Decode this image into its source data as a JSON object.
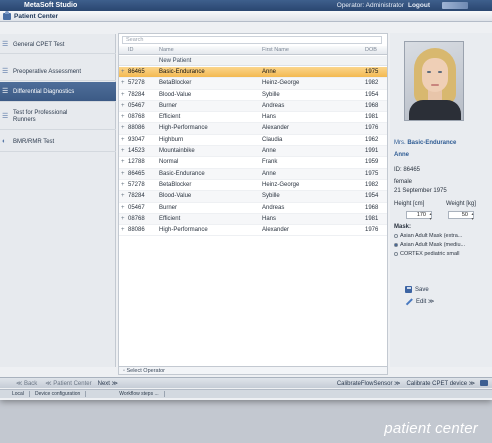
{
  "window": {
    "app_title": "MetaSoft Studio",
    "operator_label": "Operator: Administrator",
    "logout_label": "Logout",
    "section_title": "Patient Center"
  },
  "sidebar": {
    "items": [
      {
        "label": "General CPET Test",
        "icon": "run-icon",
        "active": false
      },
      {
        "label": "Preoperative Assessment",
        "icon": "run-icon",
        "active": false
      },
      {
        "label": "Differential Diagnostics",
        "icon": "stethoscope-icon",
        "active": true
      },
      {
        "label": "Test for Professional Runners",
        "icon": "run-icon",
        "active": false
      },
      {
        "label": "BMR/RMR Test",
        "icon": "bmr-icon",
        "active": false
      }
    ]
  },
  "table": {
    "search_placeholder": "Search",
    "columns": [
      "ID",
      "Name",
      "First Name",
      "DOB"
    ],
    "new_patient_label": "New Patient",
    "rows": [
      {
        "id": "86465",
        "name": "Basic-Endurance",
        "first": "Anne",
        "dob": "1975",
        "selected": true
      },
      {
        "id": "57278",
        "name": "BetaBlocker",
        "first": "Heinz-George",
        "dob": "1982"
      },
      {
        "id": "78284",
        "name": "Blood-Value",
        "first": "Sybille",
        "dob": "1954"
      },
      {
        "id": "05467",
        "name": "Burner",
        "first": "Andreas",
        "dob": "1968"
      },
      {
        "id": "08768",
        "name": "Efficient",
        "first": "Hans",
        "dob": "1981"
      },
      {
        "id": "88086",
        "name": "High-Performance",
        "first": "Alexander",
        "dob": "1976"
      },
      {
        "id": "93047",
        "name": "Highburn",
        "first": "Claudia",
        "dob": "1962"
      },
      {
        "id": "14523",
        "name": "Mountainbike",
        "first": "Anne",
        "dob": "1991"
      },
      {
        "id": "12788",
        "name": "Normal",
        "first": "Frank",
        "dob": "1959"
      },
      {
        "id": "86465",
        "name": "Basic-Endurance",
        "first": "Anne",
        "dob": "1975"
      },
      {
        "id": "57278",
        "name": "BetaBlocker",
        "first": "Heinz-George",
        "dob": "1982"
      },
      {
        "id": "78284",
        "name": "Blood-Value",
        "first": "Sybille",
        "dob": "1954"
      },
      {
        "id": "05467",
        "name": "Burner",
        "first": "Andreas",
        "dob": "1968"
      },
      {
        "id": "08768",
        "name": "Efficient",
        "first": "Hans",
        "dob": "1981"
      },
      {
        "id": "88086",
        "name": "High-Performance",
        "first": "Alexander",
        "dob": "1976"
      }
    ],
    "select_operator_label": "Select Operator"
  },
  "detail": {
    "salutation": "Mrs.",
    "last_name": "Basic-Endurance",
    "first_name": "Anne",
    "id_line": "ID: 86465",
    "sex": "female",
    "dob": "21 September 1975",
    "height_label": "Height [cm]",
    "weight_label": "Weight [kg]",
    "height_value": "170",
    "weight_value": "50",
    "mask_label": "Mask:",
    "masks": [
      {
        "label": "Asian Adult Mask (extra...",
        "checked": false
      },
      {
        "label": "Asian Adult Mask (mediu...",
        "checked": true
      },
      {
        "label": "CORTEX pediatric small",
        "checked": false
      }
    ],
    "save_label": "Save",
    "edit_label": "Edit ≫"
  },
  "navbar": {
    "back_label": "≪ Back",
    "patient_center_label": "≪ Patient Center",
    "next_label": "Next ≫",
    "calibrate_flow_label": "CalibrateFlowSensor ≫",
    "calibrate_device_label": "Calibrate CPET device ≫"
  },
  "statusbar": {
    "items": [
      "Local",
      "Device configuration",
      "Workflow steps ..."
    ]
  },
  "caption": "patient center",
  "colors": {
    "title_blue": "#2a4670",
    "selected_row": "#f3b951",
    "active_nav": "#3c5a85"
  }
}
